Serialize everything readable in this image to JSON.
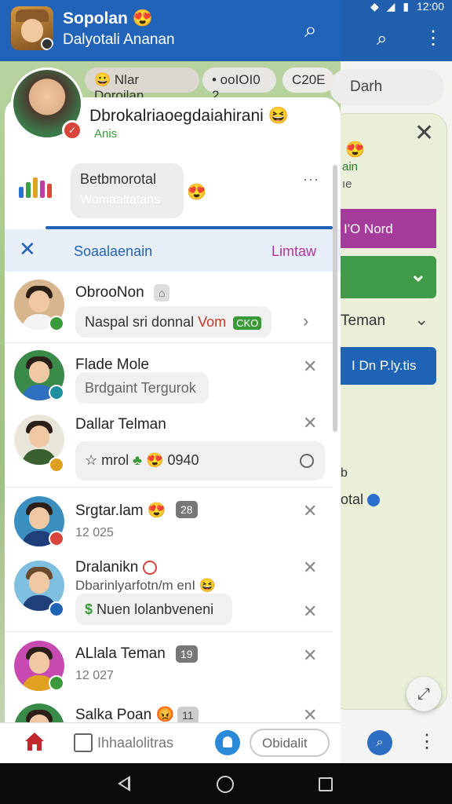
{
  "status": {
    "time": "12:00"
  },
  "background": {
    "search_text": "Darh",
    "emoji": "😍",
    "text1": "ain",
    "text2": "ıe",
    "purple_label": "I'O Nord",
    "green_chevron": "⌄",
    "teman_label": "Teman",
    "blue_button": "I Dn P.ly.tis",
    "small_b": "b",
    "total_label": "otal",
    "float_icon": "⤢",
    "more_icon": "⋮"
  },
  "header": {
    "title": "Sopolan 😍",
    "subtitle": "Dalyotali Ananan",
    "chips": [
      "😀 Nlar Doroilan",
      "• ooIOI0 2",
      "C20E"
    ]
  },
  "profile": {
    "name": "Dbrokalriaoegdaiahirani 😆",
    "sub": "Anis"
  },
  "post": {
    "bubble_line1": "Betbmorotal",
    "bubble_line2": "Womaaltatans",
    "emoji": "😍",
    "more": "···"
  },
  "filter": {
    "label": "Soaalaenain",
    "link": "Limtaw"
  },
  "friends": [
    {
      "name": "ObrooNon",
      "tag": "⌂",
      "message": "Naspal sri donnal",
      "msg_extra": "Vom",
      "msg_badge": "CKO"
    },
    {
      "name": "Flade Mole",
      "message": "Brdgaint Tergurok"
    },
    {
      "name": "Dallar Telman",
      "message": "mrol",
      "msg_emoji": "😍",
      "msg_count": "0940"
    },
    {
      "name": "Srgtar.lam 😍",
      "tag": "28",
      "timestamp": "12 025"
    },
    {
      "name": "Dralanikn",
      "sub": "Dbarinlyarfotn/m enI 😆",
      "message": "Nuen lolanbveneni"
    },
    {
      "name": "ALlala Teman",
      "tag": "19",
      "timestamp": "12 027"
    },
    {
      "name": "Salka Poan 😡",
      "tag": "11"
    }
  ],
  "bottom_nav": {
    "label": "Ihhaalolitras",
    "pill": "Obidalit"
  },
  "colors": {
    "primary": "#2163b8",
    "accent_pink": "#b0369b",
    "green": "#3a9a3a"
  }
}
